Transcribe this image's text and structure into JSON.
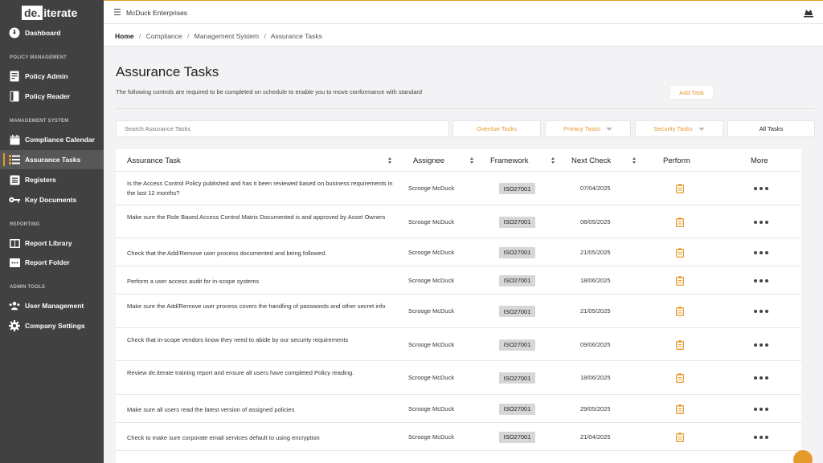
{
  "sidebar": {
    "logo_box": "de.",
    "logo_rest": "iterate",
    "dashboard": "Dashboard",
    "sections": {
      "policy": "POLICY MANAGEMENT",
      "management": "MANAGEMENT SYSTEM",
      "reporting": "REPORTING",
      "admin": "ADMIN TOOLS"
    },
    "items": {
      "policy_admin": "Policy Admin",
      "policy_reader": "Policy Reader",
      "compliance_calendar": "Compliance Calendar",
      "assurance_tasks": "Assurance Tasks",
      "registers": "Registers",
      "key_documents": "Key Documents",
      "report_library": "Report Library",
      "report_folder": "Report Folder",
      "user_management": "User Management",
      "company_settings": "Company Settings"
    }
  },
  "topbar": {
    "company": "McDuck Enterprises"
  },
  "breadcrumb": [
    "Home",
    "Compliance",
    "Management System",
    "Assurance Tasks"
  ],
  "page": {
    "title": "Assurance Tasks",
    "description": "The following controls are required to be completed on schedule to enable you to move conformance with standard",
    "add_task": "Add Task"
  },
  "search": {
    "placeholder": "Search Assurance Tasks"
  },
  "filters": {
    "overdue": "Overdue Tasks",
    "privacy": "Privacy Tasks",
    "security": "Security Tasks",
    "all": "All Tasks"
  },
  "table": {
    "headers": {
      "task": "Assurance Task",
      "assignee": "Assignee",
      "framework": "Framework",
      "next_check": "Next Check",
      "perform": "Perform",
      "more": "More"
    },
    "rows": [
      {
        "task": "Is the Access Control Policy published and has it been reviewed based on business requirements in the last 12 months?",
        "assignee": "Scrooge McDuck",
        "framework": "ISO27001",
        "next_check": "07/04/2025"
      },
      {
        "task": "Make sure the Role Based Access Control Matrix Documented is and approved by Asset Owners",
        "assignee": "Scrooge McDuck",
        "framework": "ISO27001",
        "next_check": "08/05/2025"
      },
      {
        "task": "Check that the Add/Remove user process documented and being followed.",
        "assignee": "Scrooge McDuck",
        "framework": "ISO27001",
        "next_check": "21/05/2025"
      },
      {
        "task": "Perform a user access audit for in-scope systems",
        "assignee": "Scrooge McDuck",
        "framework": "ISO27001",
        "next_check": "18/06/2025"
      },
      {
        "task": "Make sure the Add/Remove user process covers the handling of passwords and other secret info",
        "assignee": "Scrooge McDuck",
        "framework": "ISO27001",
        "next_check": "21/05/2025"
      },
      {
        "task": "Check that in-scope vendors know they need to abide by our security requirements",
        "assignee": "Scrooge McDuck",
        "framework": "ISO27001",
        "next_check": "09/06/2025"
      },
      {
        "task": "Review de.iterate training report and ensure all users have completed Policy reading.",
        "assignee": "Scrooge McDuck",
        "framework": "ISO27001",
        "next_check": "18/06/2025"
      },
      {
        "task": "Make sure all users read the latest version of assigned policies",
        "assignee": "Scrooge McDuck",
        "framework": "ISO27001",
        "next_check": "29/05/2025"
      },
      {
        "task": "Check to make sure corporate email services default to using encryption",
        "assignee": "Scrooge McDuck",
        "framework": "ISO27001",
        "next_check": "21/04/2025"
      }
    ]
  },
  "icons": {
    "perform": "clipboard-icon",
    "more": "more-dots-icon",
    "chat": "chat-bubble-icon"
  },
  "colors": {
    "accent": "#e59a2c",
    "sidebar": "#414141",
    "badge": "#d6d6d6"
  }
}
